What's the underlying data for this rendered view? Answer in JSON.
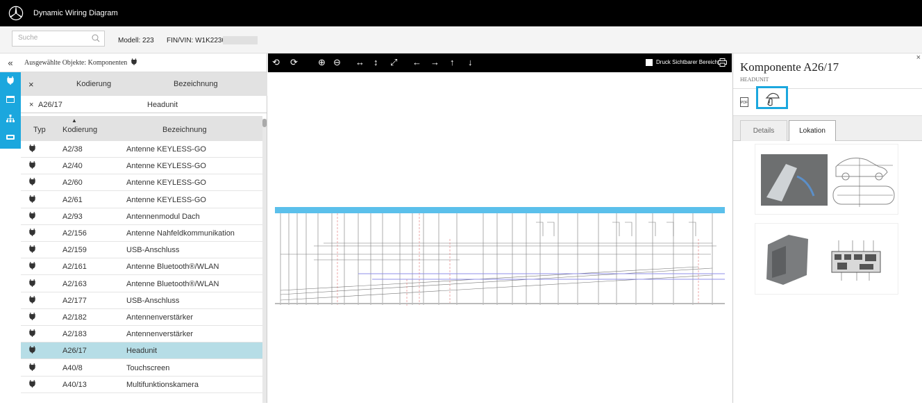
{
  "app": {
    "title": "Dynamic Wiring Diagram"
  },
  "search": {
    "placeholder": "Suche",
    "modell": "Modell: 223",
    "fin": "FIN/VIN: W1K22303"
  },
  "list": {
    "selected_header": "Ausgewählte Objekte: Komponenten",
    "selected_columns": [
      "Kodierung",
      "Bezeichnung"
    ],
    "selected_item": {
      "kodierung": "A26/17",
      "bezeichnung": "Headunit"
    },
    "columns": [
      "Typ",
      "Kodierung",
      "Bezeichnung"
    ],
    "rows": [
      {
        "kodierung": "A2/38",
        "bezeichnung": "Antenne KEYLESS-GO"
      },
      {
        "kodierung": "A2/40",
        "bezeichnung": "Antenne KEYLESS-GO"
      },
      {
        "kodierung": "A2/60",
        "bezeichnung": "Antenne KEYLESS-GO"
      },
      {
        "kodierung": "A2/61",
        "bezeichnung": "Antenne KEYLESS-GO"
      },
      {
        "kodierung": "A2/93",
        "bezeichnung": "Antennenmodul Dach"
      },
      {
        "kodierung": "A2/156",
        "bezeichnung": "Antenne Nahfeldkommunikation"
      },
      {
        "kodierung": "A2/159",
        "bezeichnung": "USB-Anschluss"
      },
      {
        "kodierung": "A2/161",
        "bezeichnung": "Antenne Bluetooth®/WLAN"
      },
      {
        "kodierung": "A2/163",
        "bezeichnung": "Antenne Bluetooth®/WLAN"
      },
      {
        "kodierung": "A2/177",
        "bezeichnung": "USB-Anschluss"
      },
      {
        "kodierung": "A2/182",
        "bezeichnung": "Antennenverstärker"
      },
      {
        "kodierung": "A2/183",
        "bezeichnung": "Antennenverstärker"
      },
      {
        "kodierung": "A26/17",
        "bezeichnung": "Headunit",
        "selected": true
      },
      {
        "kodierung": "A40/8",
        "bezeichnung": "Touchscreen"
      },
      {
        "kodierung": "A40/13",
        "bezeichnung": "Multifunktionskamera"
      }
    ]
  },
  "toolbar": {
    "druck_label": "Druck Sichtbarer Bereich"
  },
  "component": {
    "title": "Komponente A26/17",
    "subtitle": "HEADUNIT",
    "tabs": [
      "Details",
      "Lokation"
    ],
    "active_tab": "Lokation",
    "pdf_label": "PDF"
  },
  "colors": {
    "accent": "#1ba7de",
    "selected_row": "#b6dde6",
    "header_bg": "#e2e2e2",
    "titlebar": "#000000"
  }
}
